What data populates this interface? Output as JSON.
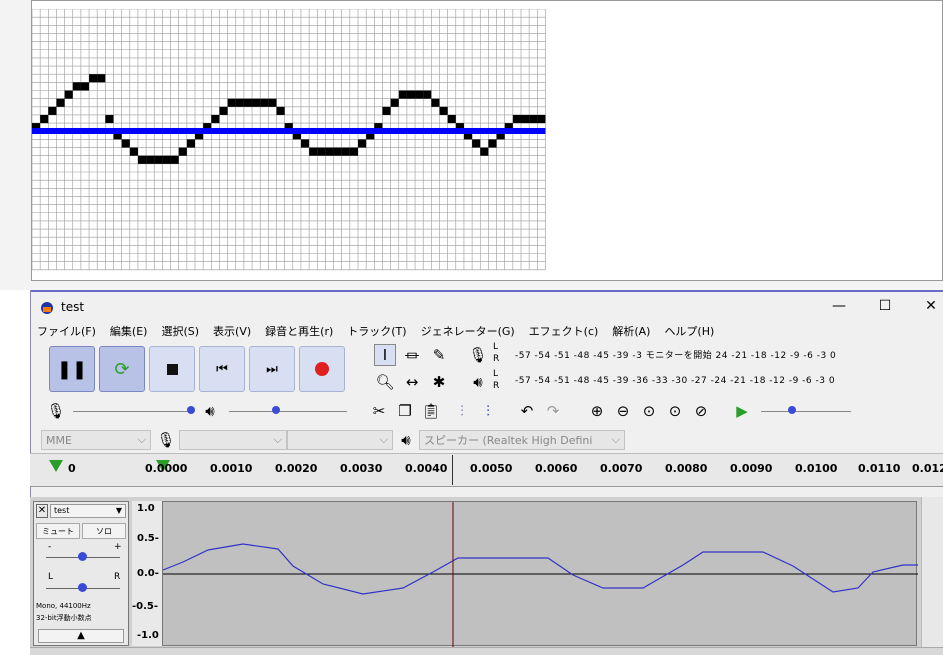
{
  "window": {
    "title": "test"
  },
  "menu": [
    "ファイル(F)",
    "編集(E)",
    "選択(S)",
    "表示(V)",
    "録音と再生(r)",
    "トラック(T)",
    "ジェネレーター(G)",
    "エフェクト(c)",
    "解析(A)",
    "ヘルプ(H)"
  ],
  "meters": {
    "record_scale": "-57 -54 -51 -48 -45    -39 -3 モニターを開始 24 -21 -18     -12 -9  -6  -3  0",
    "play_scale": "-57 -54 -51 -48 -45    -39 -36 -33 -30 -27 -24 -21 -18    -12 -9  -6  -3  0",
    "L": "L",
    "R": "R"
  },
  "device": {
    "host": "MME",
    "output": "スピーカー (Realtek High Defini"
  },
  "ruler": {
    "ticks": [
      "0",
      "0.0000",
      "0.0010",
      "0.0020",
      "0.0030",
      "0.0040",
      "0.0050",
      "0.0060",
      "0.0070",
      "0.0080",
      "0.0090",
      "0.0100",
      "0.0110",
      "0.012"
    ]
  },
  "track": {
    "name": "test",
    "mute": "ミュート",
    "solo": "ソロ",
    "gain_minus": "-",
    "gain_plus": "+",
    "pan_L": "L",
    "pan_R": "R",
    "info1": "Mono, 44100Hz",
    "info2": "32-bit浮動小数点",
    "vscale": [
      "1.0",
      "0.5-",
      "0.0-",
      "-0.5-",
      "-1.0"
    ]
  },
  "colors": {
    "accent": "#6b6bcc",
    "wave": "#3232c8",
    "wave_bg": "#c0c0c0",
    "pixel_line": "#0000ff"
  },
  "icons": [
    "pause-icon",
    "loop-icon",
    "stop-icon",
    "skip-start-icon",
    "skip-end-icon",
    "record-icon",
    "select-tool-icon",
    "envelope-tool-icon",
    "draw-tool-icon",
    "zoom-tool-icon",
    "timeshift-tool-icon",
    "multi-tool-icon",
    "mic-icon",
    "speaker-icon",
    "cut-icon",
    "copy-icon",
    "paste-icon",
    "trim-icon",
    "silence-icon",
    "undo-icon",
    "redo-icon",
    "zoom-in-icon",
    "zoom-out-icon",
    "fit-selection-icon",
    "fit-project-icon",
    "zoom-toggle-icon",
    "play-at-speed-icon"
  ]
}
